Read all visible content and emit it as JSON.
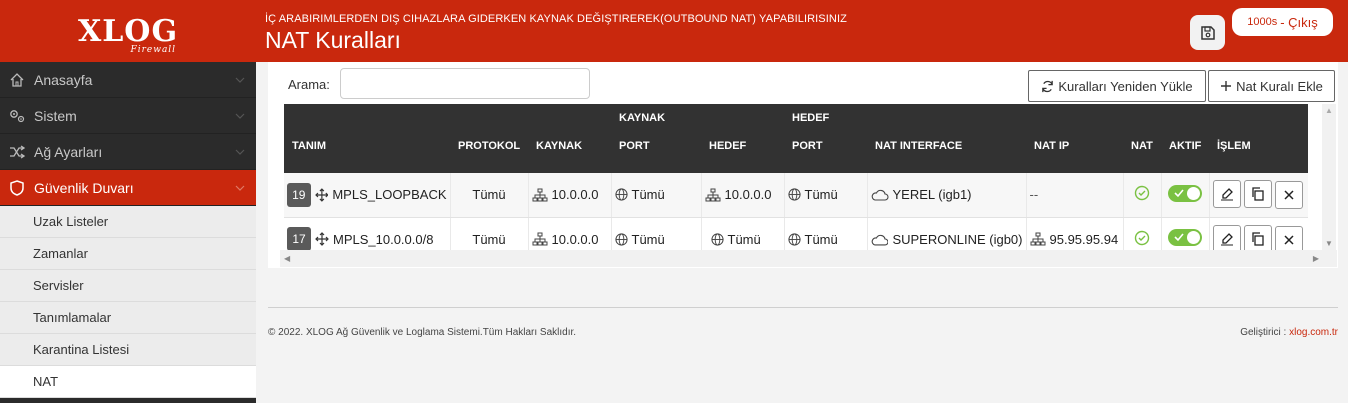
{
  "brand": {
    "logo_text": "XLOG",
    "logo_sub": "Firewall"
  },
  "header": {
    "subtitle": "İÇ ARABIRIMLERDEN DIŞ CIHAZLARA GIDERKEN KAYNAK DEĞIŞTIREREK(OUTBOUND NAT) YAPABILIRISINIZ",
    "title": "NAT Kuralları",
    "timer": "1000s",
    "logout_label": "- Çıkış"
  },
  "sidebar": {
    "items": [
      {
        "label": "Anasayfa",
        "icon": "home-icon"
      },
      {
        "label": "Sistem",
        "icon": "gears-icon"
      },
      {
        "label": "Ağ Ayarları",
        "icon": "shuffle-icon"
      },
      {
        "label": "Güvenlik Duvarı",
        "icon": "shield-icon",
        "active": true
      }
    ],
    "sub_items": [
      {
        "label": "Uzak Listeler"
      },
      {
        "label": "Zamanlar"
      },
      {
        "label": "Servisler"
      },
      {
        "label": "Tanımlamalar"
      },
      {
        "label": "Karantina Listesi"
      },
      {
        "label": "NAT",
        "current": true
      }
    ]
  },
  "toolbar": {
    "search_label": "Arama:",
    "search_value": "",
    "reload_label": "Kuralları Yeniden Yükle",
    "add_label": "Nat Kuralı Ekle"
  },
  "table": {
    "headers": {
      "tanim": "TANIM",
      "protokol": "PROTOKOL",
      "kaynak": "KAYNAK",
      "kaynak_port_1": "KAYNAK",
      "kaynak_port_2": "PORT",
      "hedef": "HEDEF",
      "hedef_port_1": "HEDEF",
      "hedef_port_2": "PORT",
      "nat_interface": "NAT INTERFACE",
      "nat_ip": "NAT IP",
      "nat": "NAT",
      "aktif": "AKTIF",
      "islem": "İŞLEM"
    },
    "rows": [
      {
        "id": "19",
        "name": "MPLS_LOOPBACK",
        "protocol": "Tümü",
        "source": "10.0.0.0",
        "source_port": "Tümü",
        "destination": "10.0.0.0",
        "destination_port": "Tümü",
        "nat_interface": "YEREL (igb1)",
        "nat_ip": "--",
        "nat_ip_has_icon": false,
        "nat_enabled": true,
        "active": true
      },
      {
        "id": "17",
        "name": "MPLS_10.0.0.0/8",
        "protocol": "Tümü",
        "source": "10.0.0.0",
        "source_port": "Tümü",
        "destination": "Tümü",
        "destination_port": "Tümü",
        "nat_interface": "SUPERONLINE (igb0)",
        "nat_ip": "95.95.95.94",
        "nat_ip_has_icon": true,
        "nat_enabled": true,
        "active": true
      }
    ]
  },
  "footer": {
    "copyright": "© 2022. XLOG Ağ Güvenlik ve Loglama Sistemi.Tüm Hakları Saklıdır.",
    "developer_label": "Geliştirici :",
    "developer_link": "xlog.com.tr"
  },
  "colors": {
    "brand_red": "#c9280d",
    "sidebar_bg": "#2b2b2b",
    "toggle_green": "#7ac142",
    "table_header_bg": "#323232"
  }
}
